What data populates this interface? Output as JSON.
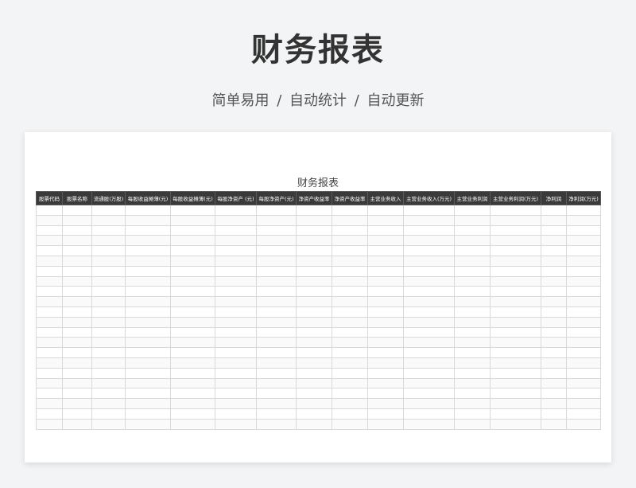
{
  "page": {
    "title": "财务报表",
    "subtitle": "简单易用  /  自动统计  /  自动更新"
  },
  "sheet": {
    "title": "财务报表",
    "columns": [
      "股票代码",
      "股票名称",
      "流通股(万股)",
      "每股收益摊薄(元)",
      "每股收益摊薄(元)",
      "每股净资产 (元)",
      "每股净资产(元)",
      "净资产收益率",
      "净资产收益率",
      "主营业务收入",
      "主营业务收入(万元)",
      "主营业务利润",
      "主营业务利润(万元)",
      "净利润",
      "净利润(万元)"
    ],
    "empty_row_count": 22
  },
  "colors": {
    "background": "#f3f4f6",
    "header_bg": "#3a3a3a",
    "header_text": "#ffffff",
    "grid": "#d9d9d9"
  }
}
